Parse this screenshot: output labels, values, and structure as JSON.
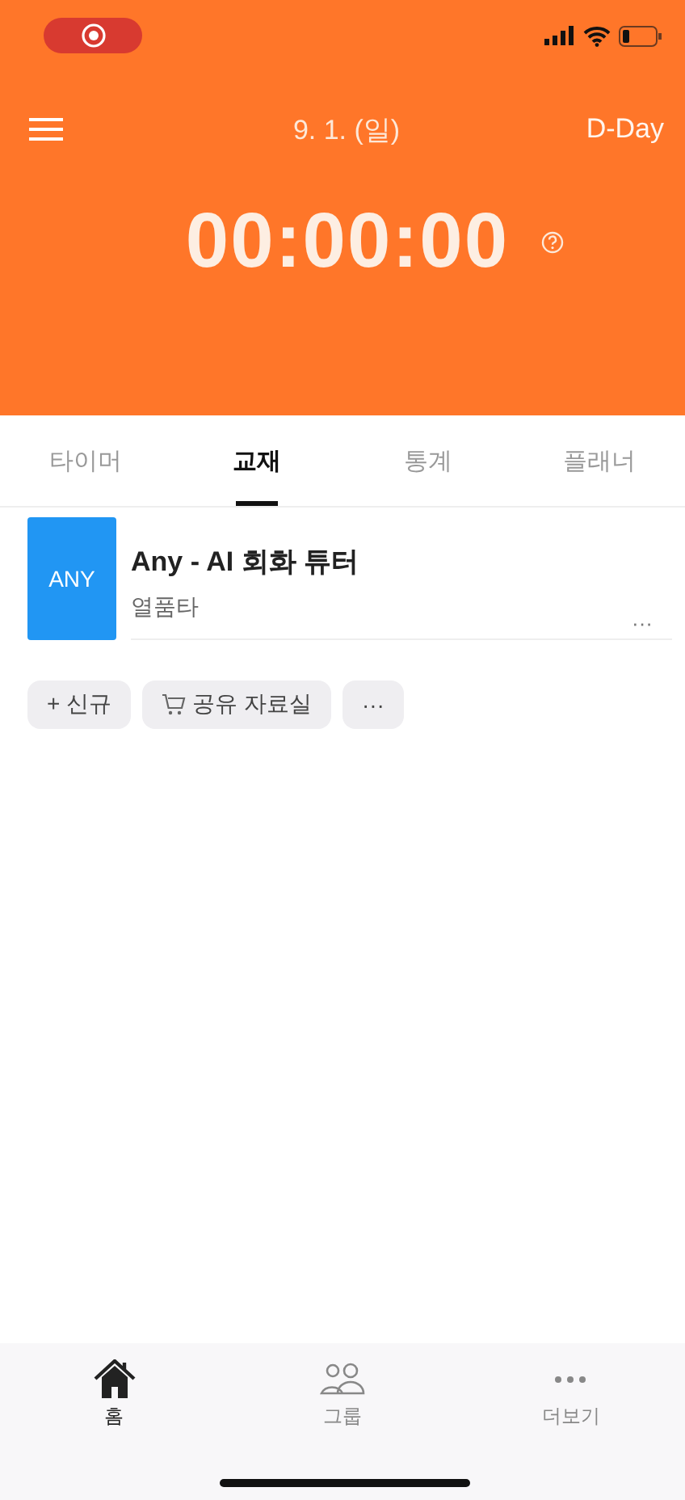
{
  "header": {
    "date": "9. 1. (일)",
    "d_day": "D-Day",
    "timer": "00:00:00"
  },
  "tabs": [
    {
      "label": "타이머",
      "selected": false
    },
    {
      "label": "교재",
      "selected": true
    },
    {
      "label": "통계",
      "selected": false
    },
    {
      "label": "플래너",
      "selected": false
    }
  ],
  "books": [
    {
      "cover": "ANY",
      "title": "Any - AI 회화 튜터",
      "publisher": "열품타",
      "more": "···"
    }
  ],
  "chips": [
    {
      "kind": "plain",
      "label": "+ 신규"
    },
    {
      "kind": "cart",
      "label": "공유 자료실"
    },
    {
      "kind": "plain",
      "label": "···"
    }
  ],
  "bottom_nav": [
    {
      "kind": "home",
      "label": "홈",
      "selected": true
    },
    {
      "kind": "group",
      "label": "그룹",
      "selected": false
    },
    {
      "kind": "more",
      "label": "더보기",
      "selected": false
    }
  ]
}
